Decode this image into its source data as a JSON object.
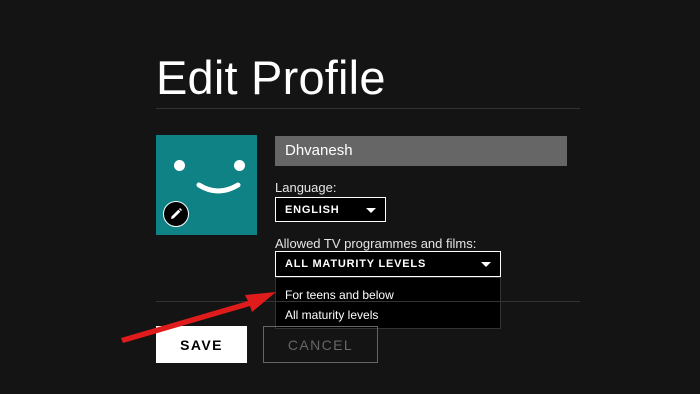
{
  "header": {
    "title": "Edit Profile"
  },
  "profile": {
    "name_value": "Dhvanesh",
    "avatar_color": "#0e8284",
    "avatar_icon": "smiley-face-icon",
    "edit_icon": "pencil-icon"
  },
  "language": {
    "label": "Language:",
    "selected": "ENGLISH"
  },
  "maturity": {
    "label": "Allowed TV programmes and films:",
    "selected": "ALL MATURITY LEVELS",
    "options": [
      "For teens and below",
      "All maturity levels"
    ]
  },
  "actions": {
    "save_label": "SAVE",
    "cancel_label": "CANCEL"
  },
  "annotation": {
    "arrow_color": "#e01b1b",
    "arrow_icon": "red-arrow-annotation"
  }
}
